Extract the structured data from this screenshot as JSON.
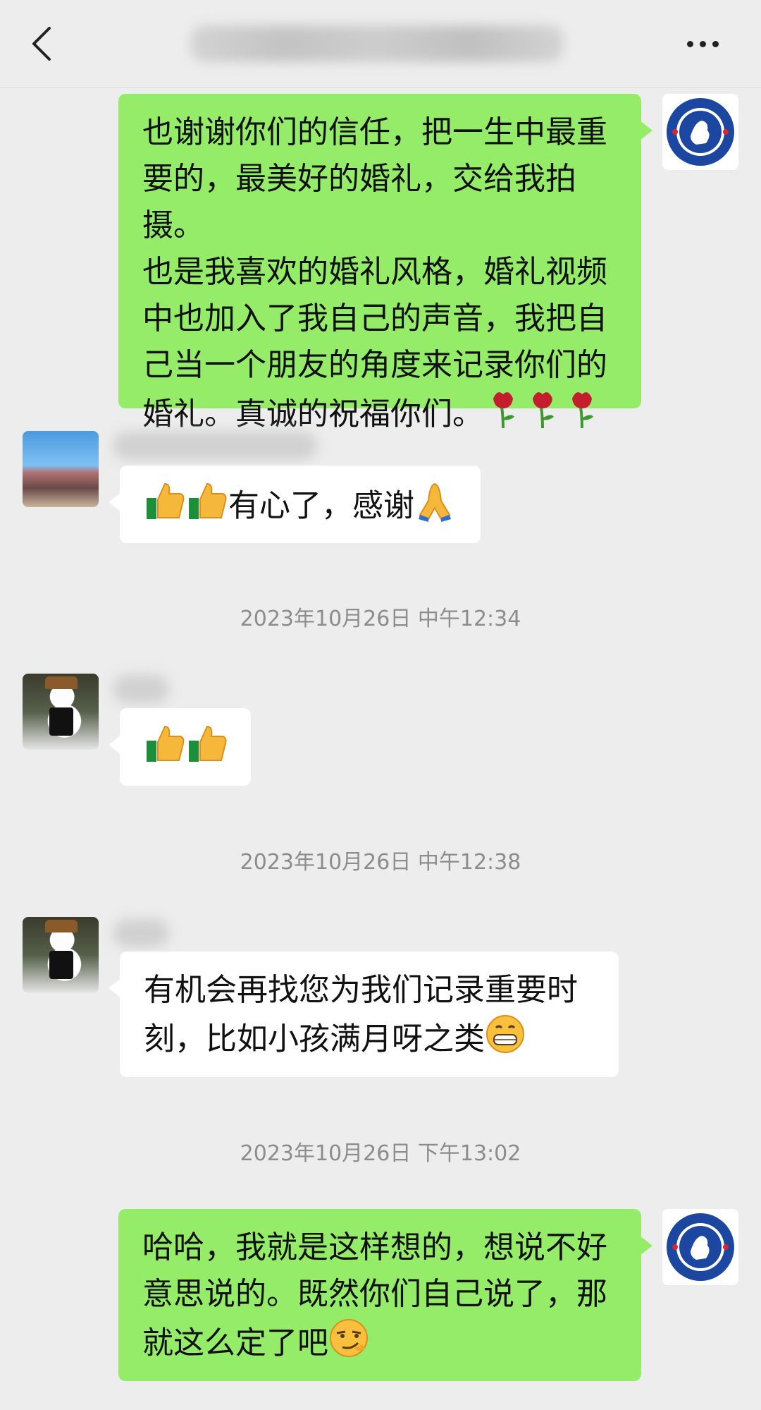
{
  "header": {
    "title": "",
    "back_icon": "chevron-left-icon",
    "more_icon": "ellipsis-icon"
  },
  "messages": [
    {
      "side": "right",
      "avatar": "chelsea-logo",
      "text": "也谢谢你们的信任，把一生中最重\n要的，最美好的婚礼，交给我拍摄。\n也是我喜欢的婚礼风格，婚礼视频\n中也加入了我自己的声音，我把自\n己当一个朋友的角度来记录你们的\n婚礼。真诚的祝福你们。",
      "emojis": [
        "rose-icon",
        "rose-icon",
        "rose-icon"
      ]
    },
    {
      "side": "left",
      "avatar": "landscape-photo",
      "text": "有心了，感谢",
      "emojis_before": [
        "thumbs-up-icon",
        "thumbs-up-icon"
      ],
      "emojis_after": [
        "folded-hands-icon"
      ]
    },
    {
      "side": "left",
      "avatar": "snowman-photo",
      "text": "",
      "emojis": [
        "thumbs-up-icon",
        "thumbs-up-icon"
      ]
    },
    {
      "side": "left",
      "avatar": "snowman-photo",
      "text": "有机会再找您为我们记录重要时\n刻，比如小孩满月呀之类",
      "emojis": [
        "grinning-face-icon"
      ]
    },
    {
      "side": "right",
      "avatar": "chelsea-logo",
      "text": "哈哈，我就是这样想的，想说不好\n意思说的。既然你们自己说了，那\n就这么定了吧",
      "emojis": [
        "smirking-face-icon"
      ]
    }
  ],
  "timestamps": [
    "2023年10月26日 中午12:34",
    "2023年10月26日 中午12:38",
    "2023年10月26日 下午13:02"
  ],
  "colors": {
    "background": "#ededed",
    "self_bubble": "#95ec69",
    "other_bubble": "#ffffff",
    "timestamp_text": "#8c8c8c"
  }
}
